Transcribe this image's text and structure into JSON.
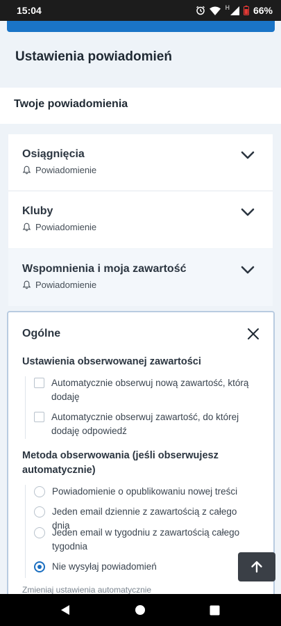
{
  "status_bar": {
    "time": "15:04",
    "battery": "66%",
    "network_letter": "H"
  },
  "header": {
    "title": "Ustawienia powiadomień"
  },
  "section": {
    "title": "Twoje powiadomienia"
  },
  "accordions": [
    {
      "title": "Osiągnięcia",
      "sub": "Powiadomienie"
    },
    {
      "title": "Kluby",
      "sub": "Powiadomienie"
    },
    {
      "title": "Wspomnienia i moja zawartość",
      "sub": "Powiadomienie"
    }
  ],
  "panel": {
    "title": "Ogólne",
    "followed_group": {
      "title": "Ustawienia obserwowanej zawartości",
      "options": [
        {
          "label": "Automatycznie obserwuj nową zawartość, którą dodaję",
          "checked": false
        },
        {
          "label": "Automatycznie obserwuj zawartość, do której dodaję odpowiedź",
          "checked": false
        }
      ]
    },
    "method_group": {
      "title": "Metoda obserwowania (jeśli obserwujesz automatycznie)",
      "options": [
        {
          "label": "Powiadomienie o opublikowaniu nowej treści",
          "selected": false
        },
        {
          "label": "Jeden email dziennie z zawartością z całego dnia",
          "selected": false
        },
        {
          "label": "Jeden email w tygodniu z zawartością całego tygodnia",
          "selected": false
        },
        {
          "label": "Nie wysyłaj powiadomień",
          "selected": true
        }
      ]
    },
    "cut_off_text": "Zmieniaj ustawienia automatycznie"
  },
  "colors": {
    "accent": "#1a6ec0",
    "cta_blue": "#1a74c7",
    "page_bg": "#eef3f8"
  }
}
